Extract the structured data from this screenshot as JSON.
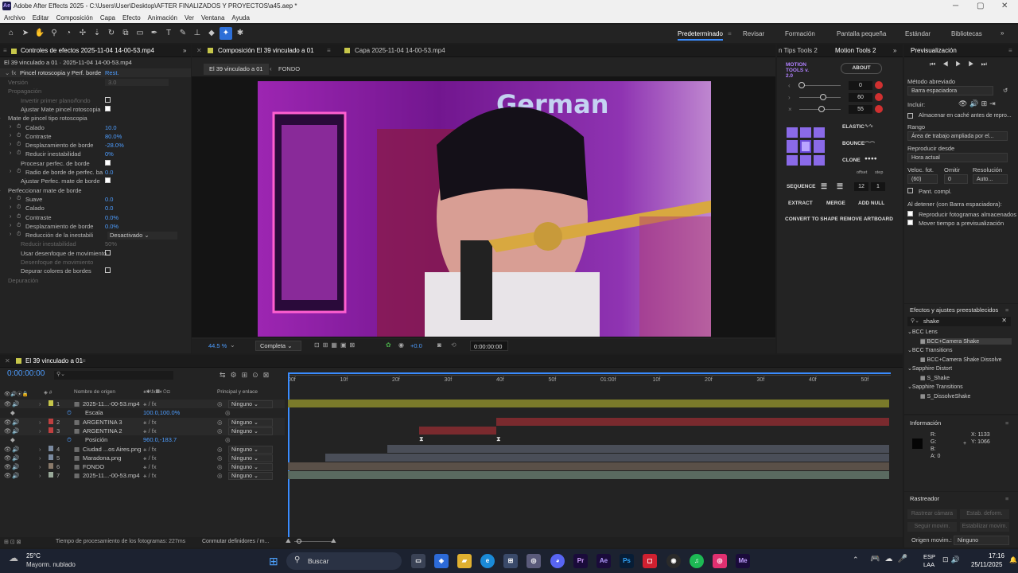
{
  "window": {
    "title": "Adobe After Effects 2025 - C:\\Users\\User\\Desktop\\AFTER FINALIZADOS Y PROYECTOS\\a45.aep *"
  },
  "menu": [
    "Archivo",
    "Editar",
    "Composición",
    "Capa",
    "Efecto",
    "Animación",
    "Ver",
    "Ventana",
    "Ayuda"
  ],
  "workspaces": [
    "Predeterminado",
    "Revisar",
    "Formación",
    "Pantalla pequeña",
    "Estándar",
    "Bibliotecas"
  ],
  "effect_controls": {
    "tab_title": "Controles de efectos 2025-11-04 14-00-53.mp4",
    "layer_path": "El 39 vinculado a 01 · 2025-11-04 14-00-53.mp4",
    "effect_name": "Pincel rotoscopia y Perf. borde",
    "reset_label": "Rest.",
    "rows": [
      {
        "label": "Versión",
        "value": "3.0",
        "dim": true
      },
      {
        "label": "Propagación",
        "value": "",
        "dim": true
      },
      {
        "label": "Invertir primer plano/fondo",
        "value": "",
        "dim": true
      },
      {
        "label": "Ajustar Mate pincel rotoscopia",
        "value": ""
      },
      {
        "label": "Mate de pincel tipo rotoscopia",
        "value": ""
      },
      {
        "label": "Calado",
        "value": "10.0"
      },
      {
        "label": "Contraste",
        "value": "80.0%"
      },
      {
        "label": "Desplazamiento de borde",
        "value": "-28.0%"
      },
      {
        "label": "Reducir inestabilidad",
        "value": "0%"
      },
      {
        "label": "Procesar perfec. de borde",
        "value": ""
      },
      {
        "label": "Radio de borde de perfec. ba",
        "value": "0.0"
      },
      {
        "label": "Ajustar Perfec. mate de borde",
        "value": ""
      },
      {
        "label": "Perfeccionar mate de borde",
        "value": ""
      },
      {
        "label": "Suave",
        "value": "0.0"
      },
      {
        "label": "Calado",
        "value": "0.0"
      },
      {
        "label": "Contraste",
        "value": "0.0%"
      },
      {
        "label": "Desplazamiento de borde",
        "value": "0.0%"
      },
      {
        "label": "Reducción de la inestabili",
        "value": "Desactivado"
      },
      {
        "label": "Reducir inestabilidad",
        "value": "50%",
        "dim": true
      },
      {
        "label": "Usar desenfoque de movimiento",
        "value": ""
      },
      {
        "label": "Desenfoque de movimiento",
        "value": "",
        "dim": true
      },
      {
        "label": "Depurar colores de bordes",
        "value": ""
      },
      {
        "label": "Depuración",
        "value": "",
        "dim": true
      }
    ]
  },
  "composition": {
    "tab_title": "Composición El 39 vinculado a 01",
    "footage_tab": "Capa 2025-11-04 14-00-53.mp4",
    "breadcrumb": [
      "El 39 vinculado a 01",
      "FONDO"
    ],
    "zoom": "44.5 %",
    "resolution": "Completa",
    "exposure": "+0.0",
    "timecode": "0:00:00:00"
  },
  "motion_tools": {
    "tabs": [
      "n Tips Tools 2",
      "Motion Tools 2"
    ],
    "logo": "MOTION TOOLS v. 2.0",
    "about": "ABOUT",
    "values": [
      "0",
      "60",
      "55"
    ],
    "buttons": [
      "ELASTIC",
      "BOUNCE",
      "CLONE",
      "SEQUENCE",
      "EXTRACT",
      "MERGE",
      "ADD NULL",
      "CONVERT TO SHAPE",
      "REMOVE ARTBOARD"
    ],
    "offset_label": "offset",
    "step_label": "step",
    "offset_value": "12",
    "step_value": "1"
  },
  "preview": {
    "title": "Previsualización",
    "shortcut_label": "Método abreviado",
    "shortcut_value": "Barra espaciadora",
    "include_label": "Incluir:",
    "cache_label": "Almacenar en caché antes de repro...",
    "range_label": "Rango",
    "range_value": "Área de trabajo ampliada por el...",
    "play_from_label": "Reproducir desde",
    "play_from_value": "Hora actual",
    "fps_label": "Veloc. fot.",
    "skip_label": "Omitir",
    "resolution_label": "Resolución",
    "fps_value": "(60)",
    "skip_value": "0",
    "resolution_value": "Auto...",
    "fullscreen_label": "Pant. compl.",
    "on_stop_label": "Al detener (con Barra espaciadora):",
    "cached_label": "Reproducir fotogramas almacenados",
    "move_time_label": "Mover tiempo a previsualización"
  },
  "effects_presets": {
    "title": "Efectos y ajustes preestablecidos",
    "search": "shake",
    "items": [
      {
        "label": "BCC Lens",
        "level": 0
      },
      {
        "label": "BCC+Camera Shake",
        "level": 1,
        "selected": true
      },
      {
        "label": "BCC Transitions",
        "level": 0
      },
      {
        "label": "BCC+Camera Shake Dissolve",
        "level": 1
      },
      {
        "label": "Sapphire Distort",
        "level": 0
      },
      {
        "label": "S_Shake",
        "level": 1
      },
      {
        "label": "Sapphire Transitions",
        "level": 0
      },
      {
        "label": "S_DissolveShake",
        "level": 1
      }
    ]
  },
  "info": {
    "title": "Información",
    "r": "R:",
    "g": "G:",
    "b": "B:",
    "a": "A:  0",
    "x": "X: 1133",
    "y": "Y: 1066"
  },
  "tracker": {
    "title": "Rastreador",
    "buttons": [
      "Rastrear cámara",
      "Estab. deform.",
      "Seguir movim.",
      "Estabilizar movim."
    ],
    "origin_label": "Origen movim.:",
    "origin_value": "Ninguno"
  },
  "timeline": {
    "comp_name": "El 39 vinculado a 01",
    "timecode": "0:00:00:00",
    "col_source": "Nombre de origen",
    "col_parent": "Principal y enlace",
    "ruler": [
      "00f",
      "10f",
      "20f",
      "30f",
      "40f",
      "50f",
      "01:00f",
      "10f",
      "20f",
      "30f",
      "40f",
      "50f"
    ],
    "layers": [
      {
        "num": "1",
        "name": "2025-11...-00-53.mp4",
        "parent": "Ninguno",
        "color": "#c7c74a"
      },
      {
        "num": "",
        "name": "Escala",
        "value": "100.0,100.0%",
        "prop": true
      },
      {
        "num": "2",
        "name": "ARGENTINA 3",
        "parent": "Ninguno",
        "color": "#c04040"
      },
      {
        "num": "3",
        "name": "ARGENTINA 2",
        "parent": "Ninguno",
        "color": "#c04040"
      },
      {
        "num": "",
        "name": "Posición",
        "value": "960.0,-183.7",
        "prop": true
      },
      {
        "num": "4",
        "name": "Ciudad ...os Aires.png",
        "parent": "Ninguno",
        "color": "#7a8aa0"
      },
      {
        "num": "5",
        "name": "Maradona.png",
        "parent": "Ninguno",
        "color": "#7a8aa0"
      },
      {
        "num": "6",
        "name": "FONDO",
        "parent": "Ninguno",
        "color": "#8a7a6a"
      },
      {
        "num": "7",
        "name": "2025-11...-00-53.mp4",
        "parent": "Ninguno",
        "color": "#9aaa9a"
      }
    ],
    "status": "Tiempo de procesamiento de los fotogramas: 227ms",
    "toggle": "Conmutar definidores / m..."
  },
  "taskbar": {
    "weather_temp": "25°C",
    "weather_desc": "Mayorm. nublado",
    "search": "Buscar",
    "lang": "ESP",
    "lang2": "LAA",
    "time": "17:16",
    "date": "25/11/2025"
  }
}
